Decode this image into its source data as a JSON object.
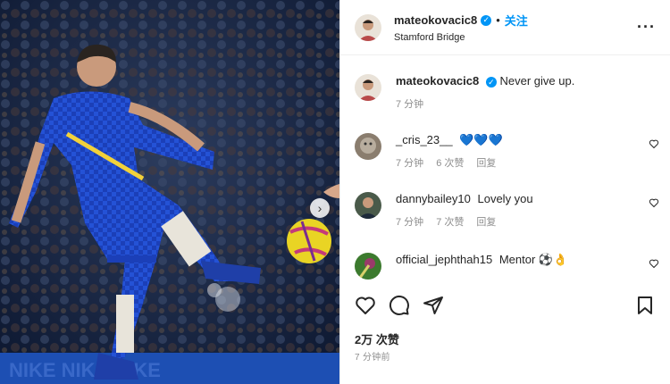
{
  "header": {
    "username": "mateokovacic8",
    "dot": "•",
    "follow_label": "关注",
    "location": "Stamford Bridge",
    "more_label": "···"
  },
  "caption": {
    "username": "mateokovacic8",
    "text": "Never give up.",
    "time": "7 分钟"
  },
  "comments": [
    {
      "username": "_cris_23__",
      "text": "💙💙💙",
      "time": "7 分钟",
      "likes": "6 次赞",
      "reply": "回复"
    },
    {
      "username": "dannybailey10",
      "text": "Lovely you",
      "time": "7 分钟",
      "likes": "7 次赞",
      "reply": "回复"
    },
    {
      "username": "official_jephthah15",
      "text": "Mentor ⚽👌",
      "time": "",
      "likes": "",
      "reply": ""
    }
  ],
  "actions": {
    "like_icon": "heart-icon",
    "comment_icon": "comment-icon",
    "share_icon": "share-icon",
    "save_icon": "bookmark-icon"
  },
  "likes_label": "2万 次赞",
  "post_time": "7 分钟前",
  "media": {
    "next_icon": "chevron-right-icon",
    "next_glyph": "›"
  },
  "colors": {
    "accent": "#0095f6",
    "jersey": "#1b3fb8",
    "muted": "#8e8e8e"
  }
}
